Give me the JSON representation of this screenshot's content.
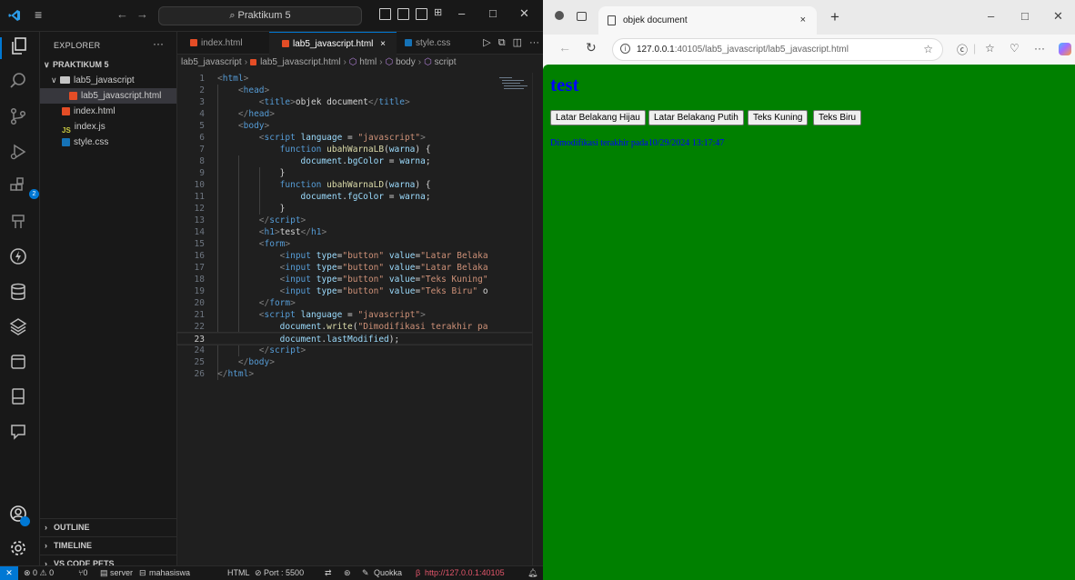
{
  "vscode": {
    "search_label": "Praktikum 5",
    "explorer": {
      "title": "EXPLORER",
      "more": "···",
      "root": "PRAKTIKUM 5",
      "folder": "lab5_javascript",
      "files": [
        {
          "name": "lab5_javascript.html"
        },
        {
          "name": "index.html"
        },
        {
          "name": "index.js",
          "prefix": "JS"
        },
        {
          "name": "style.css"
        }
      ],
      "sections": [
        "OUTLINE",
        "TIMELINE",
        "VS CODE PETS"
      ]
    },
    "tabs": [
      {
        "label": "index.html"
      },
      {
        "label": "lab5_javascript.html",
        "close": "×"
      },
      {
        "label": "style.css"
      }
    ],
    "tab_more": "···",
    "breadcrumb": [
      "lab5_javascript",
      "lab5_javascript.html",
      "html",
      "body",
      "script"
    ],
    "active_line": 23,
    "statusbar": {
      "problems": "⊗ 0 ⚠ 0",
      "ports": "⑂0",
      "server": "server",
      "user": "mahasiswa",
      "lang": "HTML",
      "port": "⊘ Port : 5500",
      "quokka": "Quokka",
      "url": "http://127.0.0.1:40105"
    },
    "badge_count": "2"
  },
  "browser": {
    "tab_title": "objek document",
    "tab_close": "×",
    "new_tab": "+",
    "address_host": "127.0.0.1",
    "address_path": ":40105/lab5_javascript/lab5_javascript.html",
    "more": "···",
    "page": {
      "bg_color": "#008000",
      "heading": "test",
      "buttons": [
        "Latar Belakang Hijau",
        "Latar Belakang Putih",
        "Teks Kuning",
        "Teks Biru"
      ],
      "note": "Dimodifikasi terakhir pada10/29/2024 13:17:47",
      "text_color": "#0000ff"
    }
  }
}
